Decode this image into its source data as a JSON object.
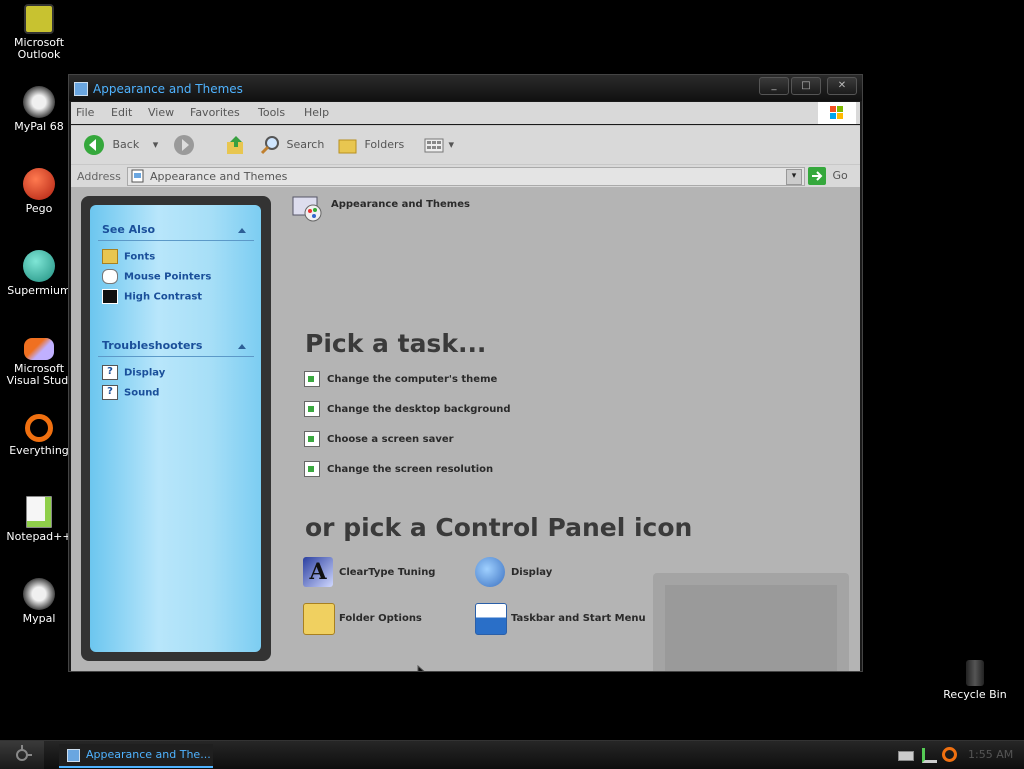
{
  "desktop_icons": [
    {
      "label": "Microsoft Outlook",
      "icon": "outlook-icon",
      "color": "#c8c230"
    },
    {
      "label": "MyPal 68",
      "icon": "mypal-icon",
      "color": "#f0f0f0"
    },
    {
      "label": "Pego",
      "icon": "pego-icon",
      "color": "#d0401a"
    },
    {
      "label": "Supermium",
      "icon": "supermium-icon",
      "color": "#2fbfa8"
    },
    {
      "label": "Microsoft Visual Studi",
      "icon": "visual-studio-icon",
      "color": "#f07020"
    },
    {
      "label": "Everything",
      "icon": "everything-icon",
      "color": "#f07010"
    },
    {
      "label": "Notepad++",
      "icon": "notepadpp-icon",
      "color": "#8fcf4a"
    },
    {
      "label": "Mypal",
      "icon": "mypal-icon",
      "color": "#f0f0f0"
    }
  ],
  "recycle_bin": {
    "label": "Recycle Bin"
  },
  "window": {
    "title": "Appearance and Themes",
    "menu": [
      "File",
      "Edit",
      "View",
      "Favorites",
      "Tools",
      "Help"
    ],
    "toolbar": {
      "back": "Back",
      "search": "Search",
      "folders": "Folders"
    },
    "address_label": "Address",
    "address_value": "Appearance and Themes",
    "go": "Go"
  },
  "sidebar": {
    "see_also_title": "See Also",
    "see_also_items": [
      "Fonts",
      "Mouse Pointers",
      "High Contrast"
    ],
    "troubleshooters_title": "Troubleshooters",
    "troubleshooters_items": [
      "Display",
      "Sound"
    ]
  },
  "main": {
    "header": "Appearance and Themes",
    "pick_task_title": "Pick a task...",
    "tasks": [
      "Change the computer's theme",
      "Change the desktop background",
      "Choose a screen saver",
      "Change the screen resolution"
    ],
    "pick_icon_title": "or pick a Control Panel icon",
    "icons": [
      "ClearType Tuning",
      "Display",
      "Folder Options",
      "Taskbar and Start Menu"
    ]
  },
  "taskbar": {
    "task_button": "Appearance and The...",
    "clock": "1:55 AM"
  },
  "colors": {
    "accent": "#4fb3ff",
    "link": "#1a4f9a"
  }
}
